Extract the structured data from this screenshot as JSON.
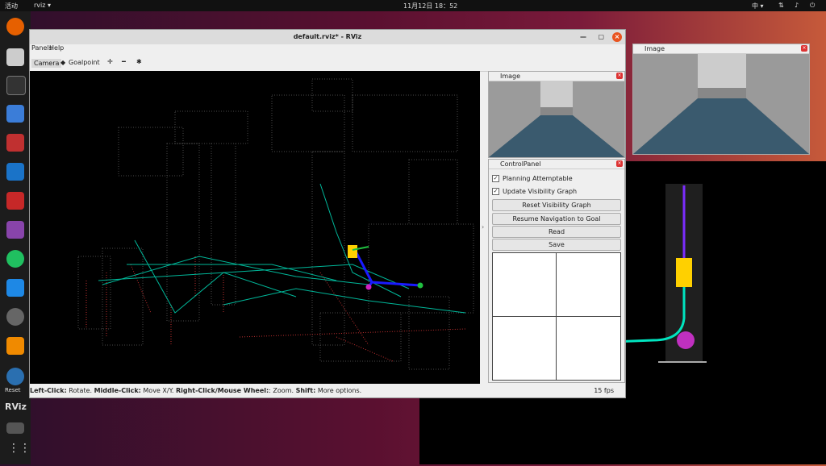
{
  "topbar": {
    "activities": "活动",
    "app_menu": "rviz ▾",
    "datetime": "11月12日 18：52",
    "input_method": "中 ▾"
  },
  "dock": {
    "reset_label": "Reset",
    "rviz_label": "RViz"
  },
  "rviz": {
    "title": "default.rviz* - RViz",
    "menu": {
      "panels": "Panels",
      "help": "Help"
    },
    "toolbar": {
      "camera": "Camera",
      "goalpoint": "Goalpoint"
    },
    "status": {
      "left_click": "Left-Click:",
      "left_action": " Rotate. ",
      "middle_click": "Middle-Click:",
      "middle_action": " Move X/Y. ",
      "right_click": "Right-Click/Mouse Wheel:",
      "right_action": ": Zoom. ",
      "shift": "Shift:",
      "shift_action": " More options."
    },
    "fps": "15 fps"
  },
  "image_panel": {
    "title": "Image"
  },
  "image_window": {
    "title": "Image"
  },
  "control_panel": {
    "title": "ControlPanel",
    "planning_attemptable": "Planning Attemptable",
    "update_visibility_graph": "Update Visibility Graph",
    "reset_visibility_graph": "Reset Visibility Graph",
    "resume_navigation": "Resume Navigation to Goal",
    "read": "Read",
    "save": "Save"
  },
  "colors": {
    "accent": "#e95420",
    "path": "#00e5c0",
    "robot": "#ffd000",
    "pink": "#d020c0"
  }
}
